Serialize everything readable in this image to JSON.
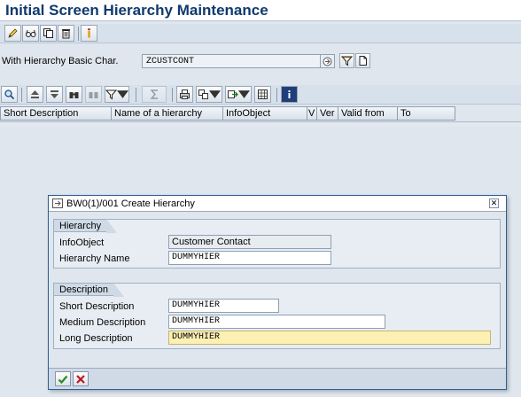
{
  "window": {
    "title": "Initial Screen Hierarchy Maintenance"
  },
  "toolbar": {
    "buttons": [
      "pencil-icon",
      "glasses-icon",
      "copy-icon",
      "trash-icon",
      "info-icon"
    ]
  },
  "selection": {
    "label": "With Hierarchy Basic Char.",
    "value": "ZCUSTCONT"
  },
  "alv": {
    "columns": [
      "Short Description",
      "Name of a hierarchy",
      "InfoObject",
      "V",
      "Ver",
      "Valid from",
      "To"
    ]
  },
  "dialog": {
    "title": "BW0(1)/001 Create Hierarchy",
    "hierarchy_group": {
      "title": "Hierarchy",
      "infoobject_label": "InfoObject",
      "infoobject_value": "Customer Contact",
      "name_label": "Hierarchy Name",
      "name_value": "DUMMYHIER"
    },
    "description_group": {
      "title": "Description",
      "short_label": "Short Description",
      "short_value": "DUMMYHIER",
      "medium_label": "Medium Description",
      "medium_value": "DUMMYHIER",
      "long_label": "Long Description",
      "long_value": "DUMMYHIER"
    }
  },
  "colors": {
    "title_text": "#0f3a6e",
    "background": "#dfe6ee",
    "focus_field": "#fdf0b3",
    "confirm_green": "#2b8a1e",
    "cancel_red": "#c0171b"
  }
}
